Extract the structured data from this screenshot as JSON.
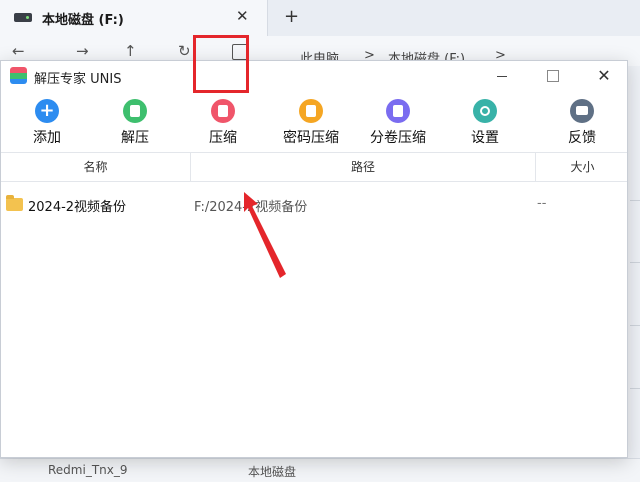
{
  "explorer": {
    "tab_title": "本地磁盘 (F:)",
    "tab_close": "✕",
    "new_tab": "+",
    "nav": [
      "←",
      "→",
      "↑",
      "↻"
    ],
    "breadcrumb": [
      "此电脑",
      ">",
      "本地磁盘 (F:)",
      ">"
    ],
    "bottom_text": [
      "Redmi_Tnx_9",
      "本地磁盘"
    ]
  },
  "app": {
    "title": "解压专家 UNIS",
    "window_controls": {
      "minimize": "—",
      "maximize": "☐",
      "close": "✕"
    },
    "toolbar": [
      {
        "label": "添加",
        "icon": "add-icon",
        "color": "#2d8cf0"
      },
      {
        "label": "解压",
        "icon": "extract-icon",
        "color": "#3ebf6e"
      },
      {
        "label": "压缩",
        "icon": "compress-icon",
        "color": "#f0556a"
      },
      {
        "label": "密码压缩",
        "icon": "password-compress-icon",
        "color": "#f5a623"
      },
      {
        "label": "分卷压缩",
        "icon": "split-compress-icon",
        "color": "#7a6cf0"
      },
      {
        "label": "设置",
        "icon": "gear-icon",
        "color": "#38b2a8"
      },
      {
        "label": "反馈",
        "icon": "feedback-icon",
        "color": "#5f7085"
      }
    ],
    "columns": {
      "name": "名称",
      "path": "路径",
      "size": "大小"
    },
    "files": [
      {
        "name": "2024-2视频备份",
        "path": "F:/2024-2视频备份",
        "size": "--"
      }
    ],
    "highlight_color": "#e4262b"
  }
}
